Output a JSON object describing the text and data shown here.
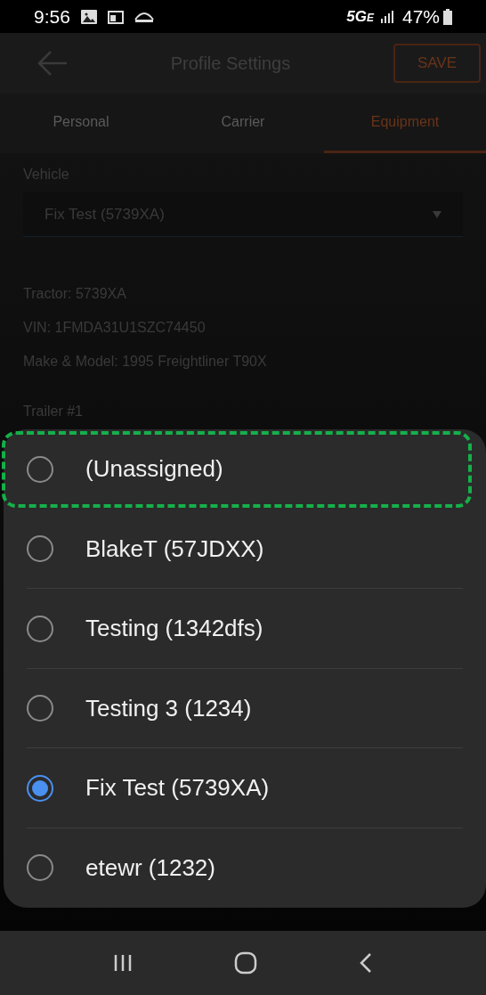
{
  "status_bar": {
    "time": "9:56",
    "network": "5G",
    "network_sub": "E",
    "battery": "47%"
  },
  "header": {
    "title": "Profile Settings",
    "save": "SAVE"
  },
  "tabs": [
    {
      "label": "Personal",
      "selected": false
    },
    {
      "label": "Carrier",
      "selected": false
    },
    {
      "label": "Equipment",
      "selected": true
    }
  ],
  "vehicle": {
    "label": "Vehicle",
    "value": "Fix Test (5739XA)"
  },
  "details": [
    "Tractor: 5739XA",
    "VIN: 1FMDA31U1SZC74450",
    "Make & Model: 1995 Freightliner T90X"
  ],
  "trailer_label": "Trailer #1",
  "options": [
    {
      "label": "(Unassigned)",
      "selected": false,
      "highlighted": true
    },
    {
      "label": "BlakeT (57JDXX)",
      "selected": false,
      "highlighted": false
    },
    {
      "label": "Testing (1342dfs)",
      "selected": false,
      "highlighted": false
    },
    {
      "label": "Testing 3 (1234)",
      "selected": false,
      "highlighted": false
    },
    {
      "label": "Fix Test (5739XA)",
      "selected": true,
      "highlighted": false
    },
    {
      "label": "etewr (1232)",
      "selected": false,
      "highlighted": false
    }
  ]
}
